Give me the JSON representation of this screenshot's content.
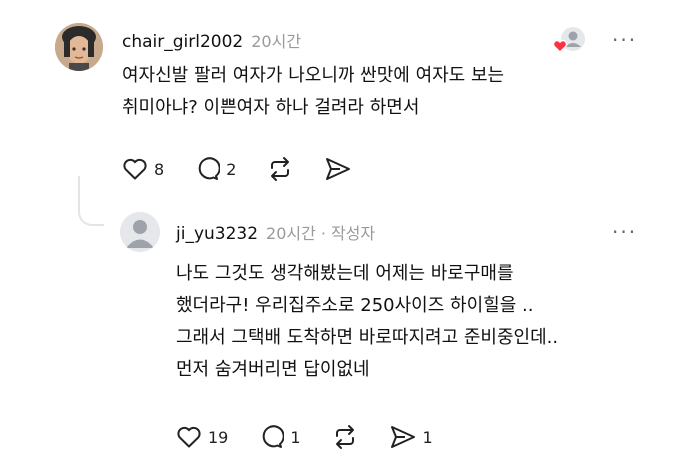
{
  "comments": [
    {
      "username": "chair_girl2002",
      "time": "20시간",
      "lines": [
        "여자신발 팔러 여자가 나오니까 싼맛에 여자도 보는",
        "취미아냐? 이쁜여자 하나 걸려라 하면서"
      ],
      "likes": "8",
      "replies": "2",
      "reposts": "",
      "shares": "",
      "more_label": "···",
      "liked_by_author": true
    },
    {
      "username": "ji_yu3232",
      "time": "20시간",
      "badge": "작성자",
      "separator": "·",
      "lines": [
        "나도 그것도 생각해봤는데 어제는 바로구매를",
        "했더라구! 우리집주소로 250사이즈 하이힐을 ..",
        "그래서 그택배 도착하면 바로따지려고 준비중인데..",
        "먼저 숨겨버리면 답이없네"
      ],
      "likes": "19",
      "replies": "1",
      "reposts": "",
      "shares": "1",
      "more_label": "···"
    }
  ],
  "colors": {
    "heart_badge": "#ff3040",
    "muted": "#9a9a9a",
    "thread_line": "#e4e4e4"
  },
  "icons": [
    "heart-icon",
    "comment-icon",
    "repost-icon",
    "share-icon",
    "more-icon",
    "person-icon"
  ]
}
